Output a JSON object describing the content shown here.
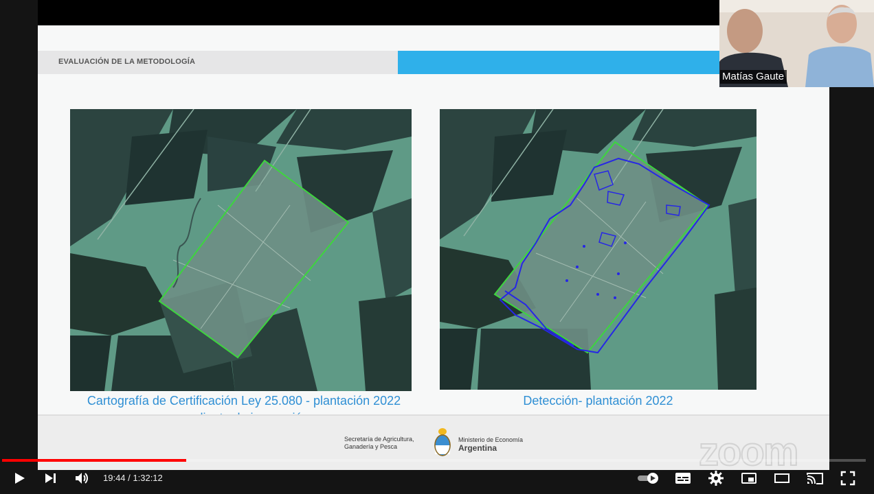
{
  "slide": {
    "section_title": "EVALUACIÓN DE LA METODOLOGÍA",
    "caption_left_line1": "Cartografía de Certificación Ley 25.080  - plantación 2022",
    "caption_left_line2": "pendiente de inspección.",
    "caption_right": "Detección- plantación 2022",
    "logo_secretaria_line1": "Secretaría de Agricultura,",
    "logo_secretaria_line2": "Ganadería y Pesca",
    "logo_ministerio_line1": "Ministerio de Economía",
    "logo_ministerio_line2": "Argentina",
    "watermark": "zoom"
  },
  "camera": {
    "participant_name": "Matías Gaute"
  },
  "player": {
    "current_time": "19:44",
    "separator": " / ",
    "duration": "1:32:12",
    "progress_fraction": 0.213
  },
  "icons": {
    "play": "play-icon",
    "next": "next-icon",
    "volume": "volume-icon",
    "autoplay": "autoplay-toggle-icon",
    "subtitles": "subtitles-icon",
    "settings": "gear-icon",
    "miniplayer": "miniplayer-icon",
    "theater": "theater-mode-icon",
    "cast": "cast-icon",
    "fullscreen": "fullscreen-icon"
  },
  "colors": {
    "header_blue": "#2fb0ea",
    "caption_blue": "#2f8fd4",
    "parcel_green": "#3dd63d",
    "detection_blue": "#2626e6",
    "progress_red": "#ff0000"
  }
}
